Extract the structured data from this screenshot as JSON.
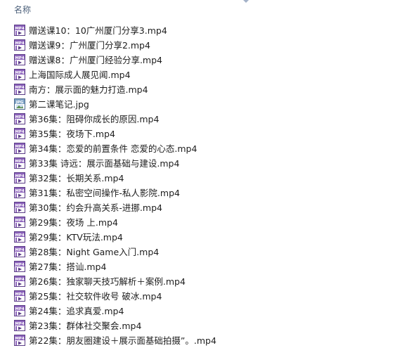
{
  "header": {
    "name_column": "名称"
  },
  "files": [
    {
      "name": "赠送课10：10广州厦门分享3.mp4",
      "icon": "video-file-icon"
    },
    {
      "name": "赠送课9：广州厦门分享2.mp4",
      "icon": "video-file-icon"
    },
    {
      "name": "赠送课8：广州厦门经验分享.mp4",
      "icon": "video-file-icon"
    },
    {
      "name": "上海国际成人展见闻.mp4",
      "icon": "video-file-icon"
    },
    {
      "name": "南方：展示面的魅力打造.mp4",
      "icon": "video-file-icon"
    },
    {
      "name": "第二课笔记.jpg",
      "icon": "image-file-icon"
    },
    {
      "name": "第36集：阻碍你成长的原因.mp4",
      "icon": "video-file-icon"
    },
    {
      "name": "第35集：夜场下.mp4",
      "icon": "video-file-icon"
    },
    {
      "name": "第34集：恋爱的前置条件 恋爱的心态.mp4",
      "icon": "video-file-icon"
    },
    {
      "name": "第33集 诗远：展示面基础与建设.mp4",
      "icon": "video-file-icon"
    },
    {
      "name": "第32集：长期关系.mp4",
      "icon": "video-file-icon"
    },
    {
      "name": "第31集：私密空间操作-私人影院.mp4",
      "icon": "video-file-icon"
    },
    {
      "name": "第30集：约会升高关系-进挪.mp4",
      "icon": "video-file-icon"
    },
    {
      "name": "第29集：夜场 上.mp4",
      "icon": "video-file-icon"
    },
    {
      "name": "第29集：KTV玩法.mp4",
      "icon": "video-file-icon"
    },
    {
      "name": "第28集：Night Game入门.mp4",
      "icon": "video-file-icon"
    },
    {
      "name": "第27集：搭讪.mp4",
      "icon": "video-file-icon"
    },
    {
      "name": "第26集：独家聊天技巧解析＋案例.mp4",
      "icon": "video-file-icon"
    },
    {
      "name": "第25集：社交软件收号 破冰.mp4",
      "icon": "video-file-icon"
    },
    {
      "name": "第24集：追求真爱.mp4",
      "icon": "video-file-icon"
    },
    {
      "name": "第23集：群体社交聚会.mp4",
      "icon": "video-file-icon"
    },
    {
      "name": "第22集：朋友圈建设＋展示面基础拍摄”。.mp4",
      "icon": "video-file-icon"
    }
  ],
  "icon_labels": {
    "video": "MP4",
    "image": "JPG"
  },
  "colors": {
    "header_text": "#4c607a",
    "row_text": "#1e1e1e",
    "video_icon_frame": "#5a3b86",
    "video_icon_band": "#8d64bc",
    "image_icon_frame": "#4c6a8c",
    "image_icon_band": "#7fa3c6",
    "sort_arrow": "#a3b1c8"
  }
}
